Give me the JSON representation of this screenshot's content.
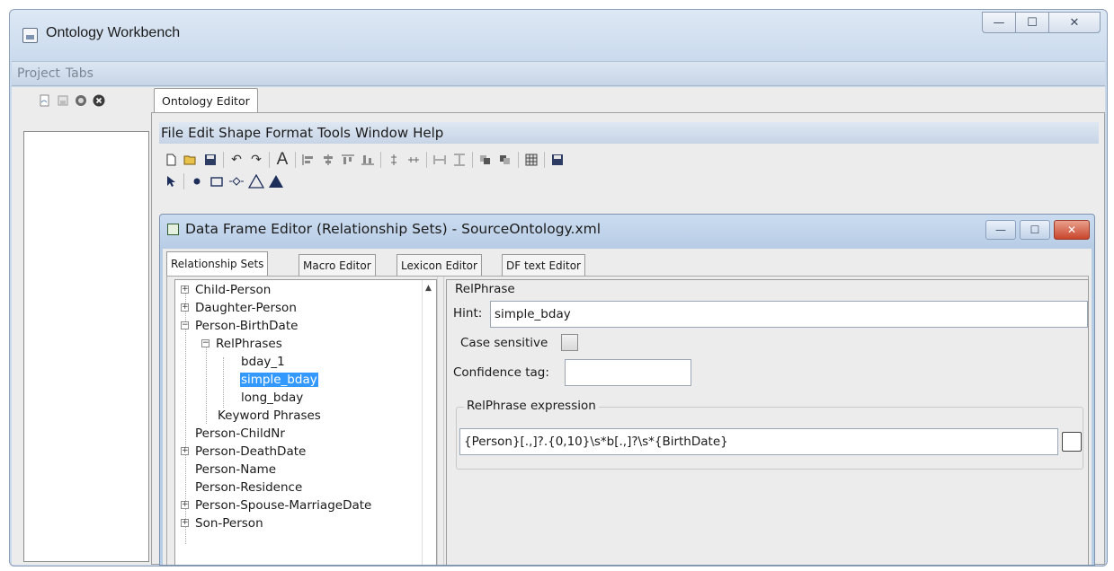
{
  "window": {
    "title": "Ontology Workbench",
    "controls": {
      "minimize": "—",
      "maximize": "☐",
      "close": "✕"
    }
  },
  "main_menu": [
    "Project",
    "Tabs"
  ],
  "left_panel": {
    "toolbar_icons": [
      "new-file-icon",
      "save-file-icon",
      "globe-icon",
      "close-circle-icon"
    ]
  },
  "tabs": [
    {
      "label": "Ontology Editor",
      "active": true
    }
  ],
  "editor_menu": [
    "File",
    "Edit",
    "Shape",
    "Format",
    "Tools",
    "Window",
    "Help"
  ],
  "toolbar1_icons": [
    "new-icon",
    "open-icon",
    "save-icon",
    "undo-icon",
    "redo-icon",
    "text-icon",
    "align-left-icon",
    "align-center-icon",
    "align-top-icon",
    "align-bottom-icon",
    "distribute-vertical-icon",
    "distribute-horizontal-icon",
    "same-width-icon",
    "same-height-icon",
    "bring-front-icon",
    "send-back-icon",
    "grid-icon",
    "save-all-icon"
  ],
  "toolbar2_icons": [
    "pointer-icon",
    "dot-icon",
    "rectangle-icon",
    "diamond-icon",
    "triangle-outline-icon",
    "triangle-filled-icon"
  ],
  "df_window": {
    "title": "Data Frame Editor (Relationship Sets) - SourceOntology.xml",
    "controls": {
      "minimize": "—",
      "maximize": "☐",
      "close": "✕"
    },
    "tabs": [
      "Relationship Sets",
      "Macro Editor",
      "Lexicon Editor",
      "DF text Editor"
    ],
    "active_tab": "Relationship Sets"
  },
  "tree": [
    {
      "label": "Child-Person",
      "level": 0,
      "expander": "+"
    },
    {
      "label": "Daughter-Person",
      "level": 0,
      "expander": "+"
    },
    {
      "label": "Person-BirthDate",
      "level": 0,
      "expander": "−"
    },
    {
      "label": "RelPhrases",
      "level": 1,
      "expander": "−"
    },
    {
      "label": "bday_1",
      "level": 2,
      "expander": ""
    },
    {
      "label": "simple_bday",
      "level": 2,
      "expander": "",
      "selected": true
    },
    {
      "label": "long_bday",
      "level": 2,
      "expander": ""
    },
    {
      "label": "Keyword Phrases",
      "level": 1,
      "expander": ""
    },
    {
      "label": "Person-ChildNr",
      "level": 0,
      "expander": ""
    },
    {
      "label": "Person-DeathDate",
      "level": 0,
      "expander": "+"
    },
    {
      "label": "Person-Name",
      "level": 0,
      "expander": ""
    },
    {
      "label": "Person-Residence",
      "level": 0,
      "expander": ""
    },
    {
      "label": "Person-Spouse-MarriageDate",
      "level": 0,
      "expander": "+"
    },
    {
      "label": "Son-Person",
      "level": 0,
      "expander": "+"
    }
  ],
  "detail": {
    "section_title": "RelPhrase",
    "hint_label": "Hint:",
    "hint_value": "simple_bday",
    "case_label": "Case sensitive",
    "case_checked": false,
    "confidence_label": "Confidence tag:",
    "confidence_value": "",
    "expression_group": "RelPhrase expression",
    "expression_value": "{Person}[.,]?.{0,10}\\s*b[.,]?\\s*{BirthDate}"
  }
}
